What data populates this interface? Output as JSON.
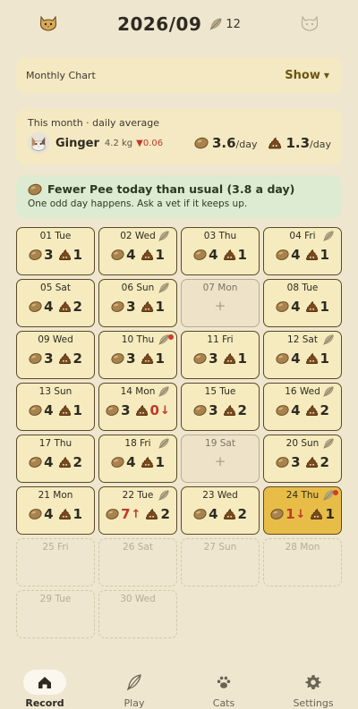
{
  "header": {
    "month": "2026/09",
    "feather_count": "12",
    "left_icon": "cat-face-icon",
    "right_icon": "cat-face-outline-icon"
  },
  "chart_card": {
    "label": "Monthly Chart",
    "toggle": "Show"
  },
  "average_card": {
    "caption": "This month · daily average",
    "cat_name": "Ginger",
    "weight": "4.2 kg",
    "weight_delta": "▼0.06",
    "pee_value": "3.6",
    "poop_value": "1.3",
    "unit": "/day"
  },
  "alert": {
    "title": "Fewer Pee today than usual (3.8 a day)",
    "subtitle": "One odd day happens. Ask a vet if it keeps up."
  },
  "days": [
    {
      "label": "01 Tue",
      "pee": "3",
      "poop": "1",
      "feather": false,
      "dot": false
    },
    {
      "label": "02 Wed",
      "pee": "4",
      "poop": "1",
      "feather": true,
      "dot": false
    },
    {
      "label": "03 Thu",
      "pee": "4",
      "poop": "1",
      "feather": false,
      "dot": false
    },
    {
      "label": "04 Fri",
      "pee": "4",
      "poop": "1",
      "feather": true,
      "dot": false
    },
    {
      "label": "05 Sat",
      "pee": "4",
      "poop": "2",
      "feather": false,
      "dot": false
    },
    {
      "label": "06 Sun",
      "pee": "3",
      "poop": "1",
      "feather": true,
      "dot": false
    },
    {
      "label": "07 Mon",
      "empty": true
    },
    {
      "label": "08 Tue",
      "pee": "4",
      "poop": "1",
      "feather": false,
      "dot": false
    },
    {
      "label": "09 Wed",
      "pee": "3",
      "poop": "2",
      "feather": false,
      "dot": false
    },
    {
      "label": "10 Thu",
      "pee": "3",
      "poop": "1",
      "feather": true,
      "dot": true
    },
    {
      "label": "11 Fri",
      "pee": "3",
      "poop": "1",
      "feather": false,
      "dot": false
    },
    {
      "label": "12 Sat",
      "pee": "4",
      "poop": "1",
      "feather": true,
      "dot": false
    },
    {
      "label": "13 Sun",
      "pee": "4",
      "poop": "1",
      "feather": false,
      "dot": false
    },
    {
      "label": "14 Mon",
      "pee": "3",
      "poop": "0",
      "poop_arrow": "↓",
      "feather": true,
      "dot": false
    },
    {
      "label": "15 Tue",
      "pee": "3",
      "poop": "2",
      "feather": false,
      "dot": false
    },
    {
      "label": "16 Wed",
      "pee": "4",
      "poop": "2",
      "feather": true,
      "dot": false
    },
    {
      "label": "17 Thu",
      "pee": "4",
      "poop": "2",
      "feather": false,
      "dot": false
    },
    {
      "label": "18 Fri",
      "pee": "4",
      "poop": "1",
      "feather": true,
      "dot": false
    },
    {
      "label": "19 Sat",
      "empty": true
    },
    {
      "label": "20 Sun",
      "pee": "3",
      "poop": "2",
      "feather": true,
      "dot": false
    },
    {
      "label": "21 Mon",
      "pee": "4",
      "poop": "1",
      "feather": false,
      "dot": false
    },
    {
      "label": "22 Tue",
      "pee": "7",
      "pee_arrow": "↑",
      "poop": "2",
      "feather": true,
      "dot": false
    },
    {
      "label": "23 Wed",
      "pee": "4",
      "poop": "2",
      "feather": false,
      "dot": false
    },
    {
      "label": "24 Thu",
      "pee": "1",
      "pee_arrow": "↓",
      "poop": "1",
      "feather": true,
      "dot": true,
      "today": true
    },
    {
      "label": "25 Fri",
      "future": true
    },
    {
      "label": "26 Sat",
      "future": true
    },
    {
      "label": "27 Sun",
      "future": true
    },
    {
      "label": "28 Mon",
      "future": true
    },
    {
      "label": "29 Tue",
      "future": true
    },
    {
      "label": "30 Wed",
      "future": true
    }
  ],
  "empty_day_symbol": "+",
  "nav": [
    {
      "label": "Record",
      "icon": "home-icon",
      "active": true
    },
    {
      "label": "Play",
      "icon": "feather-icon",
      "active": false
    },
    {
      "label": "Cats",
      "icon": "paw-icon",
      "active": false
    },
    {
      "label": "Settings",
      "icon": "gear-icon",
      "active": false
    }
  ],
  "colors": {
    "background": "#efe6cf",
    "card": "#f4e9c2",
    "alert_bg": "#dcebd2",
    "today": "#e7bd48",
    "warning": "#c0392b"
  }
}
